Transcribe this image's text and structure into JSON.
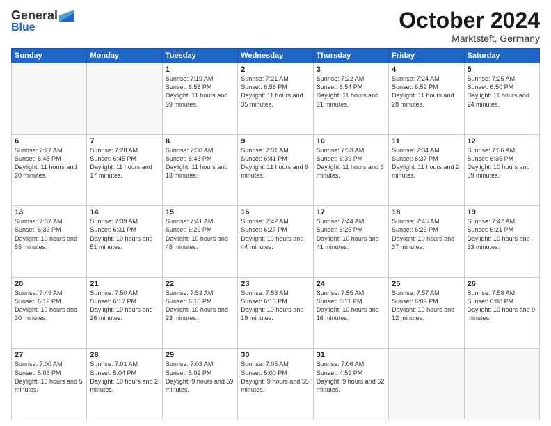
{
  "header": {
    "logo_general": "General",
    "logo_blue": "Blue",
    "month": "October 2024",
    "location": "Marktsteft, Germany"
  },
  "weekdays": [
    "Sunday",
    "Monday",
    "Tuesday",
    "Wednesday",
    "Thursday",
    "Friday",
    "Saturday"
  ],
  "weeks": [
    [
      {
        "day": "",
        "sunrise": "",
        "sunset": "",
        "daylight": ""
      },
      {
        "day": "",
        "sunrise": "",
        "sunset": "",
        "daylight": ""
      },
      {
        "day": "1",
        "sunrise": "Sunrise: 7:19 AM",
        "sunset": "Sunset: 6:58 PM",
        "daylight": "Daylight: 11 hours and 39 minutes."
      },
      {
        "day": "2",
        "sunrise": "Sunrise: 7:21 AM",
        "sunset": "Sunset: 6:56 PM",
        "daylight": "Daylight: 11 hours and 35 minutes."
      },
      {
        "day": "3",
        "sunrise": "Sunrise: 7:22 AM",
        "sunset": "Sunset: 6:54 PM",
        "daylight": "Daylight: 11 hours and 31 minutes."
      },
      {
        "day": "4",
        "sunrise": "Sunrise: 7:24 AM",
        "sunset": "Sunset: 6:52 PM",
        "daylight": "Daylight: 11 hours and 28 minutes."
      },
      {
        "day": "5",
        "sunrise": "Sunrise: 7:25 AM",
        "sunset": "Sunset: 6:50 PM",
        "daylight": "Daylight: 11 hours and 24 minutes."
      }
    ],
    [
      {
        "day": "6",
        "sunrise": "Sunrise: 7:27 AM",
        "sunset": "Sunset: 6:48 PM",
        "daylight": "Daylight: 11 hours and 20 minutes."
      },
      {
        "day": "7",
        "sunrise": "Sunrise: 7:28 AM",
        "sunset": "Sunset: 6:45 PM",
        "daylight": "Daylight: 11 hours and 17 minutes."
      },
      {
        "day": "8",
        "sunrise": "Sunrise: 7:30 AM",
        "sunset": "Sunset: 6:43 PM",
        "daylight": "Daylight: 11 hours and 13 minutes."
      },
      {
        "day": "9",
        "sunrise": "Sunrise: 7:31 AM",
        "sunset": "Sunset: 6:41 PM",
        "daylight": "Daylight: 11 hours and 9 minutes."
      },
      {
        "day": "10",
        "sunrise": "Sunrise: 7:33 AM",
        "sunset": "Sunset: 6:39 PM",
        "daylight": "Daylight: 11 hours and 6 minutes."
      },
      {
        "day": "11",
        "sunrise": "Sunrise: 7:34 AM",
        "sunset": "Sunset: 6:37 PM",
        "daylight": "Daylight: 11 hours and 2 minutes."
      },
      {
        "day": "12",
        "sunrise": "Sunrise: 7:36 AM",
        "sunset": "Sunset: 6:35 PM",
        "daylight": "Daylight: 10 hours and 59 minutes."
      }
    ],
    [
      {
        "day": "13",
        "sunrise": "Sunrise: 7:37 AM",
        "sunset": "Sunset: 6:33 PM",
        "daylight": "Daylight: 10 hours and 55 minutes."
      },
      {
        "day": "14",
        "sunrise": "Sunrise: 7:39 AM",
        "sunset": "Sunset: 6:31 PM",
        "daylight": "Daylight: 10 hours and 51 minutes."
      },
      {
        "day": "15",
        "sunrise": "Sunrise: 7:41 AM",
        "sunset": "Sunset: 6:29 PM",
        "daylight": "Daylight: 10 hours and 48 minutes."
      },
      {
        "day": "16",
        "sunrise": "Sunrise: 7:42 AM",
        "sunset": "Sunset: 6:27 PM",
        "daylight": "Daylight: 10 hours and 44 minutes."
      },
      {
        "day": "17",
        "sunrise": "Sunrise: 7:44 AM",
        "sunset": "Sunset: 6:25 PM",
        "daylight": "Daylight: 10 hours and 41 minutes."
      },
      {
        "day": "18",
        "sunrise": "Sunrise: 7:45 AM",
        "sunset": "Sunset: 6:23 PM",
        "daylight": "Daylight: 10 hours and 37 minutes."
      },
      {
        "day": "19",
        "sunrise": "Sunrise: 7:47 AM",
        "sunset": "Sunset: 6:21 PM",
        "daylight": "Daylight: 10 hours and 33 minutes."
      }
    ],
    [
      {
        "day": "20",
        "sunrise": "Sunrise: 7:49 AM",
        "sunset": "Sunset: 6:19 PM",
        "daylight": "Daylight: 10 hours and 30 minutes."
      },
      {
        "day": "21",
        "sunrise": "Sunrise: 7:50 AM",
        "sunset": "Sunset: 6:17 PM",
        "daylight": "Daylight: 10 hours and 26 minutes."
      },
      {
        "day": "22",
        "sunrise": "Sunrise: 7:52 AM",
        "sunset": "Sunset: 6:15 PM",
        "daylight": "Daylight: 10 hours and 23 minutes."
      },
      {
        "day": "23",
        "sunrise": "Sunrise: 7:53 AM",
        "sunset": "Sunset: 6:13 PM",
        "daylight": "Daylight: 10 hours and 19 minutes."
      },
      {
        "day": "24",
        "sunrise": "Sunrise: 7:55 AM",
        "sunset": "Sunset: 6:11 PM",
        "daylight": "Daylight: 10 hours and 16 minutes."
      },
      {
        "day": "25",
        "sunrise": "Sunrise: 7:57 AM",
        "sunset": "Sunset: 6:09 PM",
        "daylight": "Daylight: 10 hours and 12 minutes."
      },
      {
        "day": "26",
        "sunrise": "Sunrise: 7:58 AM",
        "sunset": "Sunset: 6:08 PM",
        "daylight": "Daylight: 10 hours and 9 minutes."
      }
    ],
    [
      {
        "day": "27",
        "sunrise": "Sunrise: 7:00 AM",
        "sunset": "Sunset: 5:06 PM",
        "daylight": "Daylight: 10 hours and 5 minutes."
      },
      {
        "day": "28",
        "sunrise": "Sunrise: 7:01 AM",
        "sunset": "Sunset: 5:04 PM",
        "daylight": "Daylight: 10 hours and 2 minutes."
      },
      {
        "day": "29",
        "sunrise": "Sunrise: 7:03 AM",
        "sunset": "Sunset: 5:02 PM",
        "daylight": "Daylight: 9 hours and 59 minutes."
      },
      {
        "day": "30",
        "sunrise": "Sunrise: 7:05 AM",
        "sunset": "Sunset: 5:00 PM",
        "daylight": "Daylight: 9 hours and 55 minutes."
      },
      {
        "day": "31",
        "sunrise": "Sunrise: 7:06 AM",
        "sunset": "Sunset: 4:59 PM",
        "daylight": "Daylight: 9 hours and 52 minutes."
      },
      {
        "day": "",
        "sunrise": "",
        "sunset": "",
        "daylight": ""
      },
      {
        "day": "",
        "sunrise": "",
        "sunset": "",
        "daylight": ""
      }
    ]
  ]
}
